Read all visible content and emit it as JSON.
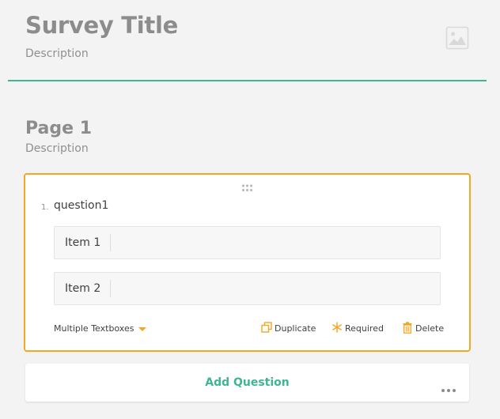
{
  "survey": {
    "title": "Survey Title",
    "description": "Description",
    "accent_color": "#3eb594",
    "logo_icon": "image-placeholder-icon"
  },
  "page": {
    "title": "Page 1",
    "description": "Description"
  },
  "question": {
    "number": "1.",
    "title": "question1",
    "selected_border_color": "#f5a623",
    "items": [
      {
        "label": "Item 1",
        "value": ""
      },
      {
        "label": "Item 2",
        "value": ""
      }
    ],
    "type_label": "Multiple Textboxes",
    "actions": {
      "duplicate": "Duplicate",
      "required": "Required",
      "delete": "Delete"
    }
  },
  "footer": {
    "add_question": "Add Question"
  }
}
